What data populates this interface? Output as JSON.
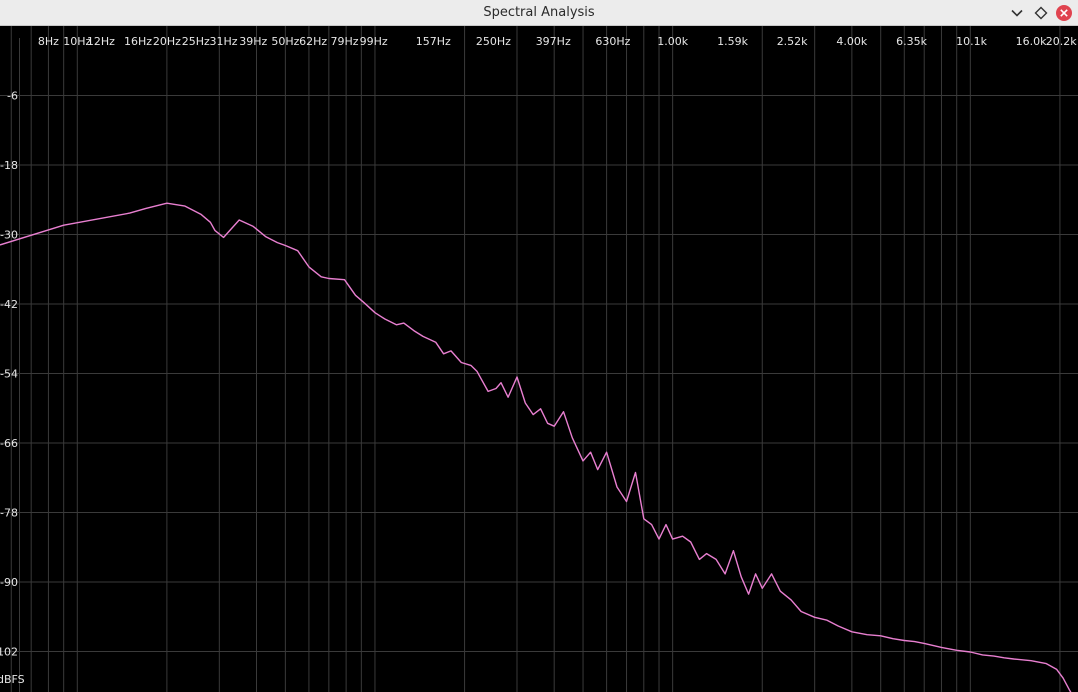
{
  "window": {
    "title": "Spectral Analysis",
    "buttons": {
      "minimize_icon": "chevron-down-icon",
      "maximize_icon": "diamond-icon",
      "close_icon": "close-icon"
    }
  },
  "colors": {
    "background": "#000000",
    "grid": "#3a3a3a",
    "trace": "#e87fd0",
    "tick_text": "#e6e6e6",
    "titlebar": "#ececec",
    "close_button": "#e0434f"
  },
  "chart_data": {
    "type": "line",
    "x_scale": "log",
    "xlim": [
      5.5,
      23000
    ],
    "ylim": [
      -109,
      6
    ],
    "grid": true,
    "y_unit_label": "dBFS",
    "x_ticks": [
      {
        "value": 8,
        "label": "8Hz"
      },
      {
        "value": 10,
        "label": "10Hz"
      },
      {
        "value": 12,
        "label": "12Hz"
      },
      {
        "value": 16,
        "label": "16Hz"
      },
      {
        "value": 20,
        "label": "20Hz"
      },
      {
        "value": 25,
        "label": "25Hz"
      },
      {
        "value": 31,
        "label": "31Hz"
      },
      {
        "value": 39,
        "label": "39Hz"
      },
      {
        "value": 50,
        "label": "50Hz"
      },
      {
        "value": 62,
        "label": "62Hz"
      },
      {
        "value": 79,
        "label": "79Hz"
      },
      {
        "value": 99,
        "label": "99Hz"
      },
      {
        "value": 157,
        "label": "157Hz"
      },
      {
        "value": 250,
        "label": "250Hz"
      },
      {
        "value": 397,
        "label": "397Hz"
      },
      {
        "value": 630,
        "label": "630Hz"
      },
      {
        "value": 1000,
        "label": "1.00k"
      },
      {
        "value": 1590,
        "label": "1.59k"
      },
      {
        "value": 2520,
        "label": "2.52k"
      },
      {
        "value": 4000,
        "label": "4.00k"
      },
      {
        "value": 6350,
        "label": "6.35k"
      },
      {
        "value": 10100,
        "label": "10.1k"
      },
      {
        "value": 16000,
        "label": "16.0k"
      },
      {
        "value": 20200,
        "label": "20.2k"
      }
    ],
    "y_ticks": [
      -6,
      -18,
      -30,
      -42,
      -54,
      -66,
      -78,
      -90,
      -102
    ],
    "y_tick_labels": [
      "-6",
      "-18",
      "-30",
      "-42",
      "-54",
      "-66",
      "-78",
      "-90",
      "-102"
    ],
    "series": [
      {
        "color": "#e87fd0",
        "x": [
          5.5,
          9,
          15,
          17,
          20,
          23,
          26,
          28,
          29,
          31,
          35,
          39,
          43,
          47,
          50,
          55,
          60,
          66,
          70,
          79,
          86,
          92,
          100,
          108,
          118,
          125,
          135,
          145,
          160,
          170,
          180,
          195,
          210,
          220,
          240,
          255,
          265,
          280,
          300,
          320,
          340,
          360,
          380,
          400,
          430,
          460,
          500,
          530,
          560,
          600,
          650,
          700,
          750,
          800,
          850,
          900,
          950,
          1000,
          1080,
          1150,
          1230,
          1300,
          1400,
          1500,
          1600,
          1700,
          1800,
          1900,
          2000,
          2150,
          2300,
          2500,
          2700,
          3000,
          3300,
          3600,
          4000,
          4500,
          5000,
          5500,
          6000,
          6500,
          7000,
          8000,
          9000,
          10000,
          11000,
          12000,
          13000,
          14000,
          16000,
          18000,
          19500,
          20500,
          21500,
          22000
        ],
        "y": [
          -31.8,
          -28.4,
          -26.3,
          -25.5,
          -24.6,
          -25.1,
          -26.5,
          -27.9,
          -29.3,
          -30.5,
          -27.5,
          -28.6,
          -30.4,
          -31.4,
          -31.9,
          -32.8,
          -35.6,
          -37.3,
          -37.6,
          -37.8,
          -40.5,
          -41.8,
          -43.5,
          -44.6,
          -45.6,
          -45.3,
          -46.6,
          -47.6,
          -48.6,
          -50.6,
          -50.1,
          -52.1,
          -52.6,
          -53.6,
          -57.1,
          -56.6,
          -55.6,
          -58.1,
          -54.6,
          -59.1,
          -61.1,
          -60.1,
          -62.6,
          -63.1,
          -60.6,
          -65.1,
          -69.1,
          -67.6,
          -70.6,
          -67.6,
          -73.6,
          -76.1,
          -71.1,
          -79.1,
          -80.1,
          -82.6,
          -80.1,
          -82.6,
          -82.1,
          -83.1,
          -86.1,
          -85.1,
          -86.1,
          -88.6,
          -84.6,
          -89.1,
          -92.1,
          -88.6,
          -91.1,
          -88.6,
          -91.6,
          -93.1,
          -95.1,
          -96.1,
          -96.6,
          -97.6,
          -98.6,
          -99.1,
          -99.3,
          -99.8,
          -100.1,
          -100.3,
          -100.6,
          -101.3,
          -101.8,
          -102.1,
          -102.6,
          -102.8,
          -103.1,
          -103.3,
          -103.6,
          -104.1,
          -105.1,
          -106.6,
          -108.6,
          -109.5
        ]
      }
    ]
  }
}
